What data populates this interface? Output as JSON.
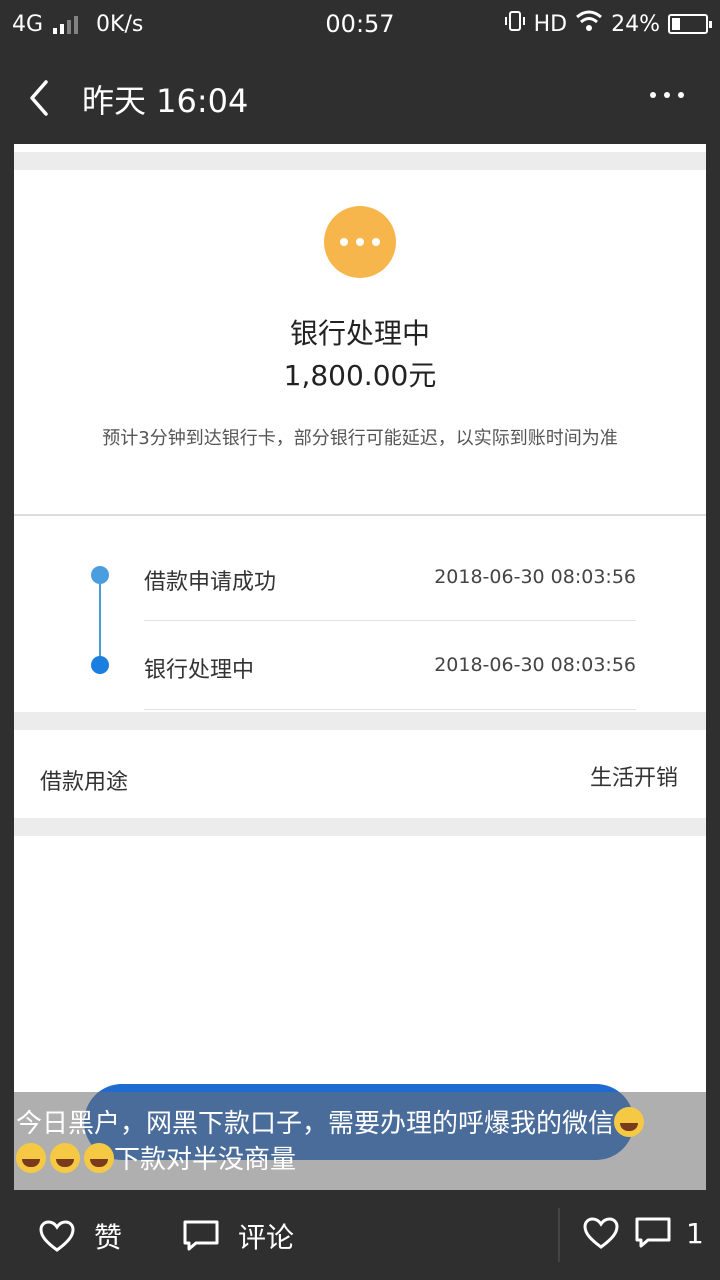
{
  "status_bar": {
    "network": "4G",
    "speed": "0K/s",
    "time": "00:57",
    "hd": "HD",
    "battery": "24%",
    "battery_level": 0.24
  },
  "header": {
    "title": "昨天 16:04"
  },
  "screenshot": {
    "status_title": "银行处理中",
    "amount": "1,800.00元",
    "note": "预计3分钟到达银行卡，部分银行可能延迟，以实际到账时间为准",
    "timeline": [
      {
        "label": "借款申请成功",
        "time": "2018-06-30 08:03:56"
      },
      {
        "label": "银行处理中",
        "time": "2018-06-30 08:03:56"
      }
    ],
    "purpose_label": "借款用途",
    "purpose_value": "生活开销"
  },
  "caption": {
    "part1": "今日黑户，网黑下款口子，需要办理的呼爆我的微信",
    "part2": "下款对半没商量"
  },
  "bottom_bar": {
    "like_label": "赞",
    "comment_label": "评论",
    "comment_count": "1"
  },
  "colors": {
    "accent_blue": "#4a9ee0",
    "pending_orange": "#f7b64b"
  }
}
